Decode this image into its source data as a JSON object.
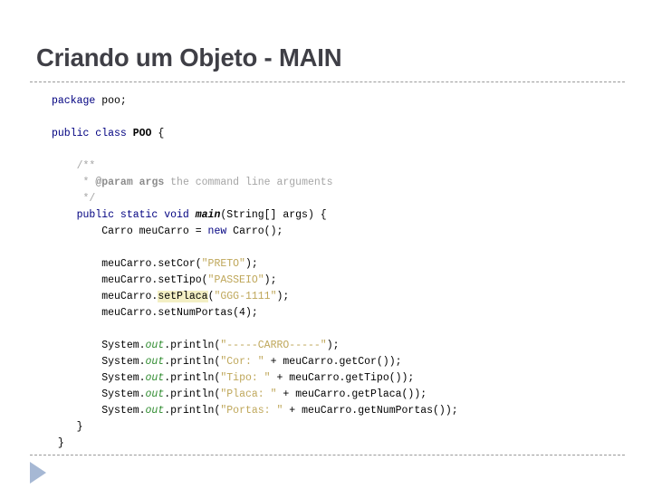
{
  "slide": {
    "title": "Criando um Objeto - MAIN",
    "background_color": "#ffffff",
    "title_color": "#3f3f46",
    "rule_color": "#9a9a9a",
    "marker_color": "#a6b8d4",
    "marker_icon": "play-triangle-icon"
  },
  "palette": {
    "keyword": "#000080",
    "string": "#bfa75a",
    "comment": "#a6a6a6",
    "field": "#2e8b2e",
    "plain": "#000000",
    "highlight_background": "#f3efc4"
  },
  "code": {
    "language": "java",
    "highlighted_token": "setPlaca",
    "lines": [
      {
        "indent": 0,
        "tokens": [
          {
            "t": "package ",
            "c": "kw"
          },
          {
            "t": "poo;",
            "c": "plain"
          }
        ]
      },
      {
        "indent": 0,
        "tokens": []
      },
      {
        "indent": 0,
        "tokens": [
          {
            "t": "public class ",
            "c": "kw"
          },
          {
            "t": "POO",
            "c": "cls"
          },
          {
            "t": " {",
            "c": "plain"
          }
        ]
      },
      {
        "indent": 0,
        "tokens": []
      },
      {
        "indent": 4,
        "tokens": [
          {
            "t": "/**",
            "c": "cmt"
          }
        ]
      },
      {
        "indent": 5,
        "tokens": [
          {
            "t": "* ",
            "c": "cmt"
          },
          {
            "t": "@param args",
            "c": "cmtb"
          },
          {
            "t": " the command line arguments",
            "c": "cmt"
          }
        ]
      },
      {
        "indent": 5,
        "tokens": [
          {
            "t": "*/",
            "c": "cmt"
          }
        ]
      },
      {
        "indent": 4,
        "tokens": [
          {
            "t": "public static void ",
            "c": "kw"
          },
          {
            "t": "main",
            "c": "mth"
          },
          {
            "t": "(String[] args) {",
            "c": "plain"
          }
        ]
      },
      {
        "indent": 8,
        "tokens": [
          {
            "t": "Carro meuCarro = ",
            "c": "plain"
          },
          {
            "t": "new",
            "c": "kw"
          },
          {
            "t": " Carro();",
            "c": "plain"
          }
        ]
      },
      {
        "indent": 0,
        "tokens": []
      },
      {
        "indent": 8,
        "tokens": [
          {
            "t": "meuCarro.setCor(",
            "c": "plain"
          },
          {
            "t": "\"PRETO\"",
            "c": "str"
          },
          {
            "t": ");",
            "c": "plain"
          }
        ]
      },
      {
        "indent": 8,
        "tokens": [
          {
            "t": "meuCarro.setTipo(",
            "c": "plain"
          },
          {
            "t": "\"PASSEIO\"",
            "c": "str"
          },
          {
            "t": ");",
            "c": "plain"
          }
        ]
      },
      {
        "indent": 8,
        "tokens": [
          {
            "t": "meuCarro.",
            "c": "plain"
          },
          {
            "t": "setPlaca",
            "c": "plain hl"
          },
          {
            "t": "(",
            "c": "plain"
          },
          {
            "t": "\"GGG-1111\"",
            "c": "str"
          },
          {
            "t": ");",
            "c": "plain"
          }
        ]
      },
      {
        "indent": 8,
        "tokens": [
          {
            "t": "meuCarro.setNumPortas(4);",
            "c": "plain"
          }
        ]
      },
      {
        "indent": 0,
        "tokens": []
      },
      {
        "indent": 8,
        "tokens": [
          {
            "t": "System.",
            "c": "plain"
          },
          {
            "t": "out",
            "c": "fld"
          },
          {
            "t": ".println(",
            "c": "plain"
          },
          {
            "t": "\"-----CARRO-----\"",
            "c": "str"
          },
          {
            "t": ");",
            "c": "plain"
          }
        ]
      },
      {
        "indent": 8,
        "tokens": [
          {
            "t": "System.",
            "c": "plain"
          },
          {
            "t": "out",
            "c": "fld"
          },
          {
            "t": ".println(",
            "c": "plain"
          },
          {
            "t": "\"Cor: \"",
            "c": "str"
          },
          {
            "t": " + meuCarro.getCor());",
            "c": "plain"
          }
        ]
      },
      {
        "indent": 8,
        "tokens": [
          {
            "t": "System.",
            "c": "plain"
          },
          {
            "t": "out",
            "c": "fld"
          },
          {
            "t": ".println(",
            "c": "plain"
          },
          {
            "t": "\"Tipo: \"",
            "c": "str"
          },
          {
            "t": " + meuCarro.getTipo());",
            "c": "plain"
          }
        ]
      },
      {
        "indent": 8,
        "tokens": [
          {
            "t": "System.",
            "c": "plain"
          },
          {
            "t": "out",
            "c": "fld"
          },
          {
            "t": ".println(",
            "c": "plain"
          },
          {
            "t": "\"Placa: \"",
            "c": "str"
          },
          {
            "t": " + meuCarro.getPlaca());",
            "c": "plain"
          }
        ]
      },
      {
        "indent": 8,
        "tokens": [
          {
            "t": "System.",
            "c": "plain"
          },
          {
            "t": "out",
            "c": "fld"
          },
          {
            "t": ".println(",
            "c": "plain"
          },
          {
            "t": "\"Portas: \"",
            "c": "str"
          },
          {
            "t": " + meuCarro.getNumPortas());",
            "c": "plain"
          }
        ]
      },
      {
        "indent": 4,
        "tokens": [
          {
            "t": "}",
            "c": "plain"
          }
        ]
      },
      {
        "indent": 1,
        "tokens": [
          {
            "t": "}",
            "c": "plain"
          }
        ]
      }
    ]
  }
}
